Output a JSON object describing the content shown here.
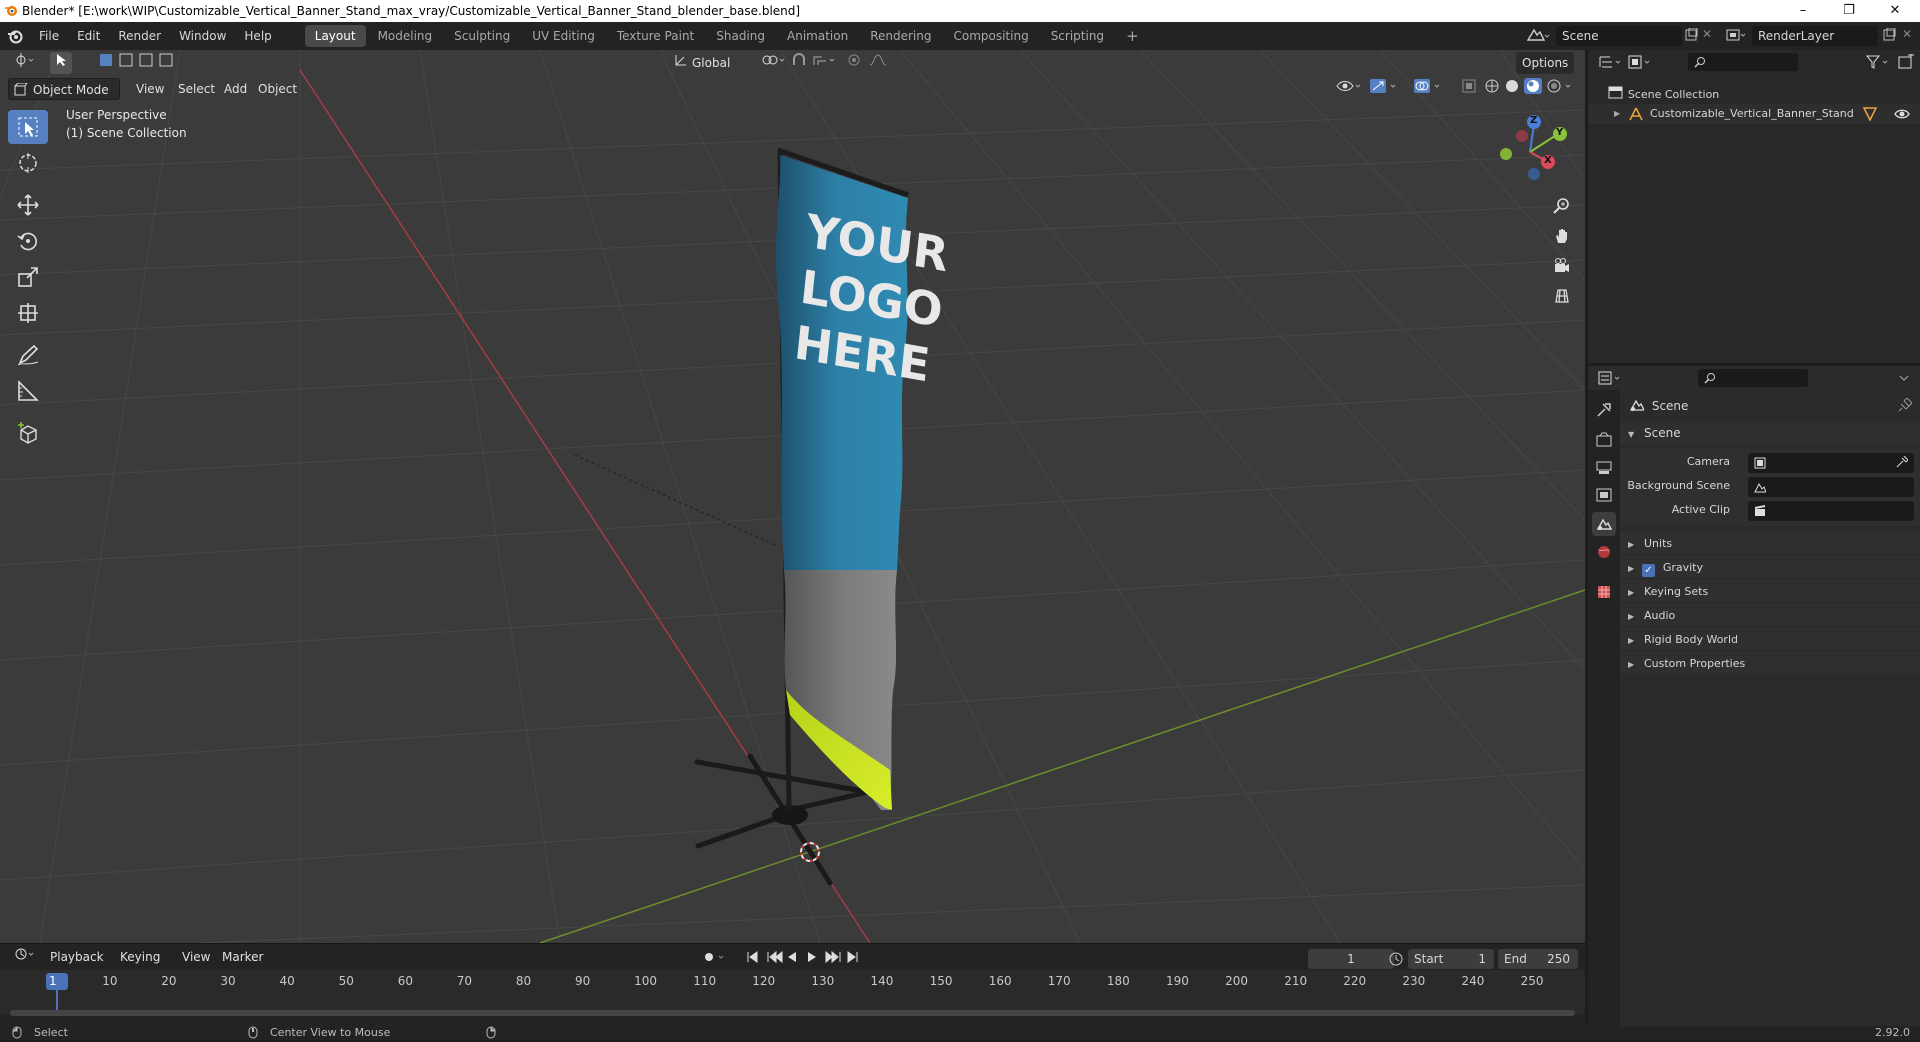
{
  "window": {
    "title": "Blender* [E:\\work\\WIP\\Customizable_Vertical_Banner_Stand_max_vray/Customizable_Vertical_Banner_Stand_blender_base.blend]",
    "minimize": "–",
    "maximize": "❐",
    "close": "✕"
  },
  "menu": [
    "File",
    "Edit",
    "Render",
    "Window",
    "Help"
  ],
  "workspaces": [
    "Layout",
    "Modeling",
    "Sculpting",
    "UV Editing",
    "Texture Paint",
    "Shading",
    "Animation",
    "Rendering",
    "Compositing",
    "Scripting"
  ],
  "add_workspace": "+",
  "scene_selector": {
    "value": "Scene"
  },
  "render_layer": {
    "value": "RenderLayer"
  },
  "viewport": {
    "mode": "Object Mode",
    "menus": [
      "View",
      "Select",
      "Add",
      "Object"
    ],
    "orientation": "Global",
    "options": "Options",
    "overlay_line1": "User Perspective",
    "overlay_line2": "(1) Scene Collection",
    "banner_text": [
      "YOUR",
      "LOGO",
      "HERE"
    ],
    "gizmo": {
      "x": "X",
      "y": "Y",
      "z": "Z"
    }
  },
  "outliner": {
    "root": "Scene Collection",
    "items": [
      {
        "label": "Customizable_Vertical_Banner_Stand"
      }
    ]
  },
  "properties": {
    "context": "Scene",
    "section": "Scene",
    "fields": [
      {
        "label": "Camera",
        "value": ""
      },
      {
        "label": "Background Scene",
        "value": ""
      },
      {
        "label": "Active Clip",
        "value": ""
      }
    ],
    "panels": [
      "Units",
      "Gravity",
      "Keying Sets",
      "Audio",
      "Rigid Body World",
      "Custom Properties"
    ],
    "gravity_checked": true
  },
  "timeline": {
    "menus": [
      "Playback",
      "Keying",
      "View",
      "Marker"
    ],
    "current_frame": "1",
    "start_label": "Start",
    "start": "1",
    "end_label": "End",
    "end": "250",
    "ticks": [
      "1",
      "10",
      "20",
      "30",
      "40",
      "50",
      "60",
      "70",
      "80",
      "90",
      "100",
      "110",
      "120",
      "130",
      "140",
      "150",
      "160",
      "170",
      "180",
      "190",
      "200",
      "210",
      "220",
      "230",
      "240",
      "250"
    ]
  },
  "status": {
    "left": "Select",
    "middle": "Center View to Mouse",
    "version": "2.92.0"
  },
  "colors": {
    "accent": "#5680c2",
    "x_axis": "#d94a5a",
    "y_axis": "#8ac33a",
    "z_axis": "#4a7fd9"
  }
}
